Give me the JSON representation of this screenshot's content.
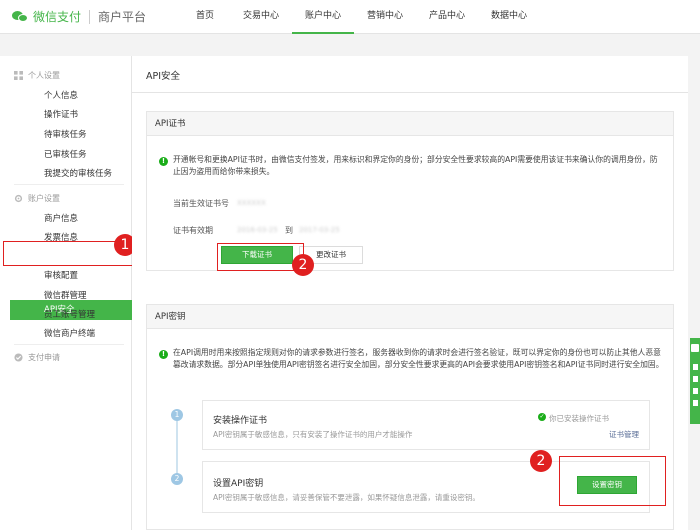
{
  "brand": {
    "name": "微信支付",
    "sub": "商户平台"
  },
  "nav": [
    {
      "label": "首页"
    },
    {
      "label": "交易中心"
    },
    {
      "label": "账户中心"
    },
    {
      "label": "营销中心"
    },
    {
      "label": "产品中心"
    },
    {
      "label": "数据中心"
    }
  ],
  "sidebar": {
    "personal": {
      "title": "个人设置",
      "items": [
        "个人信息",
        "操作证书",
        "待审核任务",
        "已审核任务",
        "我提交的审核任务"
      ]
    },
    "account": {
      "title": "账户设置",
      "items": [
        "商户信息",
        "发票信息",
        "API安全",
        "审核配置",
        "微信群管理",
        "员工账号管理",
        "微信商户终端"
      ]
    },
    "payment": {
      "title": "支付申请"
    }
  },
  "main": {
    "title": "API安全",
    "cert_panel": {
      "title": "API证书",
      "info": "开通帐号和更换API证书时，由微信支付签发，用来标识和界定你的身份；部分安全性要求较高的API需要使用该证书来确认你的调用身份，防止因为盗用而给你带来损失。",
      "serial_label": "当前生效证书号",
      "serial_value": "XXXXXX",
      "validity_label": "证书有效期",
      "validity_from": "2016-03-25",
      "validity_to_word": "到",
      "validity_to": "2017-03-25",
      "download_label": "下载证书",
      "change_label": "更改证书"
    },
    "key_panel": {
      "title": "API密钥",
      "info": "在API调用时用来按照指定规则对你的请求参数进行签名，服务器收到你的请求时会进行签名验证，既可以界定你的身份也可以防止其他人恶意篡改请求数据。部分API单独使用API密钥签名进行安全加固，部分安全性要求更高的API会要求使用API密钥签名和API证书同时进行安全加固。",
      "steps": [
        {
          "num": "1",
          "title": "安装操作证书",
          "desc": "API密钥属于敏感信息，只有安装了操作证书的用户才能操作",
          "status": "你已安装操作证书",
          "link": "证书管理"
        },
        {
          "num": "2",
          "title": "设置API密钥",
          "desc": "API密钥属于敏感信息，请妥善保管不要泄露，如果怀疑信息泄露，请重设密钥。",
          "button": "设置密钥"
        }
      ]
    }
  },
  "annotations": {
    "badge1": "1",
    "badge2a": "2",
    "badge2b": "2"
  },
  "colors": {
    "accent": "#44b549",
    "annotation": "#e02020",
    "link": "#576b95"
  }
}
